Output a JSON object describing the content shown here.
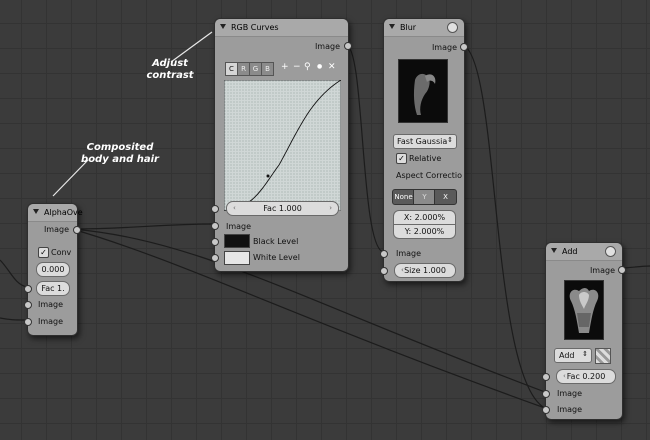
{
  "annotations": {
    "adjust_contrast": "Adjust\ncontrast",
    "composited": "Composited\nbody and hair"
  },
  "alpha_over": {
    "title": "AlphaOve",
    "output_image": "Image",
    "convert_label": "Conv",
    "value": "0.000",
    "fac": "Fac 1.",
    "input1": "Image",
    "input2": "Image"
  },
  "rgb_curves": {
    "title": "RGB Curves",
    "output_image": "Image",
    "channels": [
      "C",
      "R",
      "G",
      "B"
    ],
    "tools": [
      "+",
      "−",
      "⚲",
      "●",
      "✕"
    ],
    "fac": "Fac 1.000",
    "image_label": "Image",
    "black_level": "Black Level",
    "white_level": "White Level",
    "black_color": "#111111",
    "white_color": "#e6e6e6"
  },
  "blur": {
    "title": "Blur",
    "output_image": "Image",
    "filter": "Fast Gaussia",
    "relative_label": "Relative",
    "aspect_label": "Aspect Correctio",
    "aspect_options": [
      "None",
      "Y",
      "X"
    ],
    "x_value": "X: 2.000%",
    "y_value": "Y: 2.000%",
    "image_label": "Image",
    "size": "Size 1.000"
  },
  "add": {
    "title": "Add",
    "output_image": "Image",
    "blend_mode": "Add",
    "fac": "Fac 0.200",
    "input1": "Image",
    "input2": "Image"
  }
}
